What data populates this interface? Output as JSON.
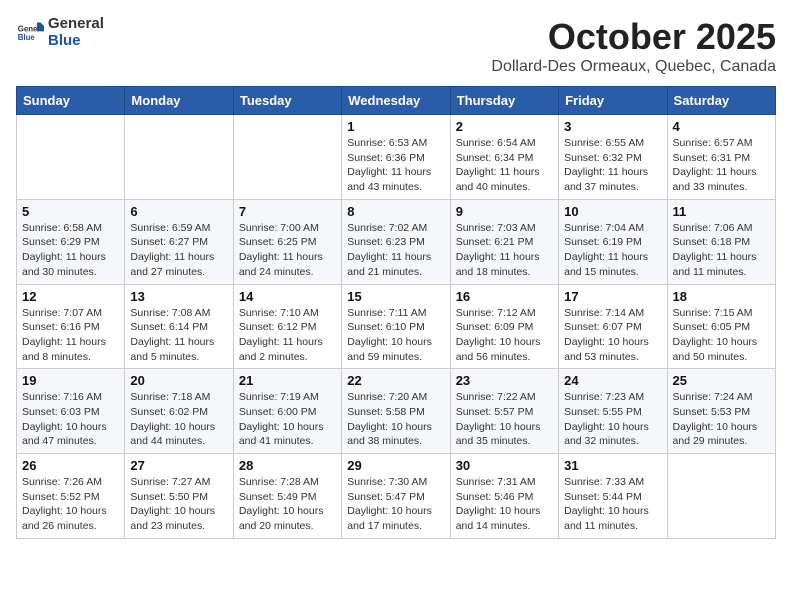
{
  "header": {
    "logo_general": "General",
    "logo_blue": "Blue",
    "month": "October 2025",
    "location": "Dollard-Des Ormeaux, Quebec, Canada"
  },
  "days_of_week": [
    "Sunday",
    "Monday",
    "Tuesday",
    "Wednesday",
    "Thursday",
    "Friday",
    "Saturday"
  ],
  "weeks": [
    [
      {
        "day": "",
        "info": ""
      },
      {
        "day": "",
        "info": ""
      },
      {
        "day": "",
        "info": ""
      },
      {
        "day": "1",
        "info": "Sunrise: 6:53 AM\nSunset: 6:36 PM\nDaylight: 11 hours and 43 minutes."
      },
      {
        "day": "2",
        "info": "Sunrise: 6:54 AM\nSunset: 6:34 PM\nDaylight: 11 hours and 40 minutes."
      },
      {
        "day": "3",
        "info": "Sunrise: 6:55 AM\nSunset: 6:32 PM\nDaylight: 11 hours and 37 minutes."
      },
      {
        "day": "4",
        "info": "Sunrise: 6:57 AM\nSunset: 6:31 PM\nDaylight: 11 hours and 33 minutes."
      }
    ],
    [
      {
        "day": "5",
        "info": "Sunrise: 6:58 AM\nSunset: 6:29 PM\nDaylight: 11 hours and 30 minutes."
      },
      {
        "day": "6",
        "info": "Sunrise: 6:59 AM\nSunset: 6:27 PM\nDaylight: 11 hours and 27 minutes."
      },
      {
        "day": "7",
        "info": "Sunrise: 7:00 AM\nSunset: 6:25 PM\nDaylight: 11 hours and 24 minutes."
      },
      {
        "day": "8",
        "info": "Sunrise: 7:02 AM\nSunset: 6:23 PM\nDaylight: 11 hours and 21 minutes."
      },
      {
        "day": "9",
        "info": "Sunrise: 7:03 AM\nSunset: 6:21 PM\nDaylight: 11 hours and 18 minutes."
      },
      {
        "day": "10",
        "info": "Sunrise: 7:04 AM\nSunset: 6:19 PM\nDaylight: 11 hours and 15 minutes."
      },
      {
        "day": "11",
        "info": "Sunrise: 7:06 AM\nSunset: 6:18 PM\nDaylight: 11 hours and 11 minutes."
      }
    ],
    [
      {
        "day": "12",
        "info": "Sunrise: 7:07 AM\nSunset: 6:16 PM\nDaylight: 11 hours and 8 minutes."
      },
      {
        "day": "13",
        "info": "Sunrise: 7:08 AM\nSunset: 6:14 PM\nDaylight: 11 hours and 5 minutes."
      },
      {
        "day": "14",
        "info": "Sunrise: 7:10 AM\nSunset: 6:12 PM\nDaylight: 11 hours and 2 minutes."
      },
      {
        "day": "15",
        "info": "Sunrise: 7:11 AM\nSunset: 6:10 PM\nDaylight: 10 hours and 59 minutes."
      },
      {
        "day": "16",
        "info": "Sunrise: 7:12 AM\nSunset: 6:09 PM\nDaylight: 10 hours and 56 minutes."
      },
      {
        "day": "17",
        "info": "Sunrise: 7:14 AM\nSunset: 6:07 PM\nDaylight: 10 hours and 53 minutes."
      },
      {
        "day": "18",
        "info": "Sunrise: 7:15 AM\nSunset: 6:05 PM\nDaylight: 10 hours and 50 minutes."
      }
    ],
    [
      {
        "day": "19",
        "info": "Sunrise: 7:16 AM\nSunset: 6:03 PM\nDaylight: 10 hours and 47 minutes."
      },
      {
        "day": "20",
        "info": "Sunrise: 7:18 AM\nSunset: 6:02 PM\nDaylight: 10 hours and 44 minutes."
      },
      {
        "day": "21",
        "info": "Sunrise: 7:19 AM\nSunset: 6:00 PM\nDaylight: 10 hours and 41 minutes."
      },
      {
        "day": "22",
        "info": "Sunrise: 7:20 AM\nSunset: 5:58 PM\nDaylight: 10 hours and 38 minutes."
      },
      {
        "day": "23",
        "info": "Sunrise: 7:22 AM\nSunset: 5:57 PM\nDaylight: 10 hours and 35 minutes."
      },
      {
        "day": "24",
        "info": "Sunrise: 7:23 AM\nSunset: 5:55 PM\nDaylight: 10 hours and 32 minutes."
      },
      {
        "day": "25",
        "info": "Sunrise: 7:24 AM\nSunset: 5:53 PM\nDaylight: 10 hours and 29 minutes."
      }
    ],
    [
      {
        "day": "26",
        "info": "Sunrise: 7:26 AM\nSunset: 5:52 PM\nDaylight: 10 hours and 26 minutes."
      },
      {
        "day": "27",
        "info": "Sunrise: 7:27 AM\nSunset: 5:50 PM\nDaylight: 10 hours and 23 minutes."
      },
      {
        "day": "28",
        "info": "Sunrise: 7:28 AM\nSunset: 5:49 PM\nDaylight: 10 hours and 20 minutes."
      },
      {
        "day": "29",
        "info": "Sunrise: 7:30 AM\nSunset: 5:47 PM\nDaylight: 10 hours and 17 minutes."
      },
      {
        "day": "30",
        "info": "Sunrise: 7:31 AM\nSunset: 5:46 PM\nDaylight: 10 hours and 14 minutes."
      },
      {
        "day": "31",
        "info": "Sunrise: 7:33 AM\nSunset: 5:44 PM\nDaylight: 10 hours and 11 minutes."
      },
      {
        "day": "",
        "info": ""
      }
    ]
  ]
}
